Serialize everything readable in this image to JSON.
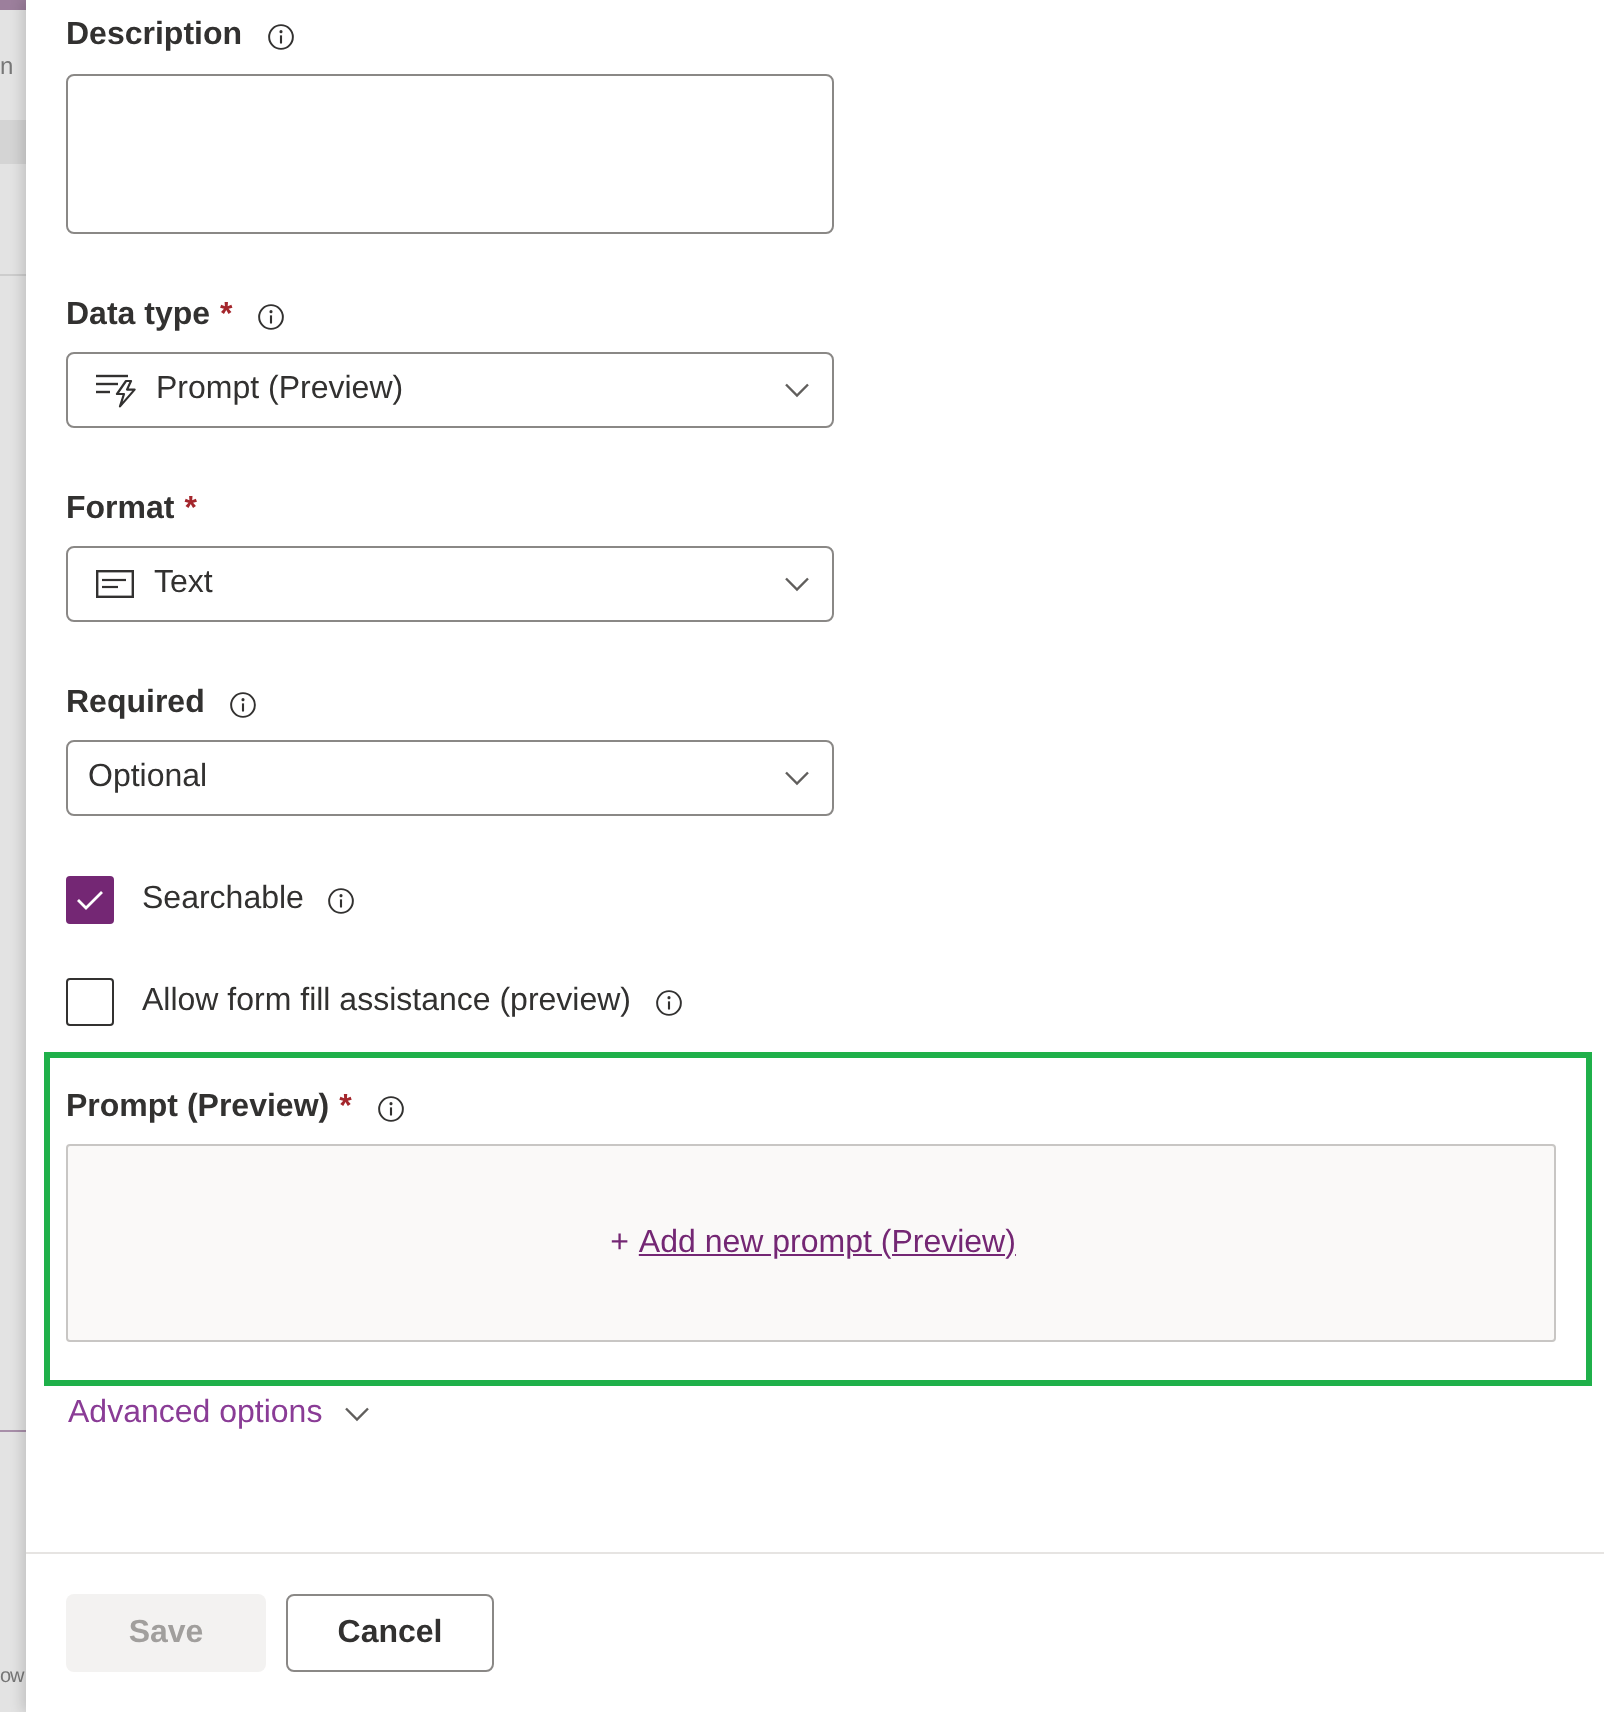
{
  "backdrop": {
    "texts": [
      "n",
      "ow"
    ]
  },
  "fields": [
    {
      "kind": "textarea",
      "label": "Description",
      "info": true
    },
    {
      "kind": "select",
      "label": "Data type",
      "required_marker": "*",
      "info": true,
      "value": {
        "kind": "prompt",
        "text": "Prompt (Preview)"
      }
    },
    {
      "kind": "select",
      "label": "Format",
      "required_marker": "*",
      "info": false,
      "value": {
        "kind": "text",
        "text": "Text"
      }
    },
    {
      "kind": "select",
      "label": "Required",
      "info": true,
      "value": {
        "kind": "plain",
        "text": "Optional"
      }
    },
    {
      "kind": "checkbox",
      "label": "Searchable",
      "checked": true,
      "info": true
    },
    {
      "kind": "checkbox",
      "label": "Allow form fill assistance (preview)",
      "checked": false,
      "info": true
    },
    {
      "kind": "prompt",
      "label": "Prompt (Preview)",
      "required_marker": "*",
      "info": true,
      "highlighted": true,
      "action_symbol": "+",
      "action": "Add new prompt (Preview)"
    }
  ],
  "advanced_options": {
    "label": "Advanced options",
    "expanded": false
  },
  "buttons": [
    {
      "label": "Save",
      "kind": "primary",
      "disabled": true
    },
    {
      "label": "Cancel",
      "kind": "secondary",
      "disabled": false
    }
  ]
}
